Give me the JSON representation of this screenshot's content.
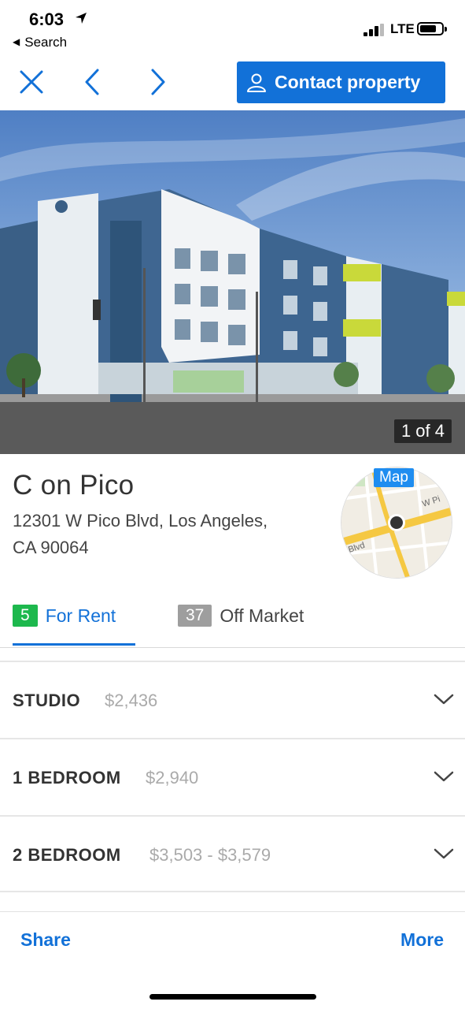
{
  "status_bar": {
    "time": "6:03",
    "back_label": "Search",
    "network": "LTE"
  },
  "nav": {
    "contact_label": "Contact property"
  },
  "gallery": {
    "counter": "1 of 4"
  },
  "property": {
    "name": "C on Pico",
    "address_line1": "12301 W Pico Blvd, Los Angeles,",
    "address_line2": "CA 90064",
    "map_label": "Map",
    "map_street_1": "W Pi",
    "map_street_2": "Blvd"
  },
  "tabs": [
    {
      "count": "5",
      "label": "For Rent"
    },
    {
      "count": "37",
      "label": "Off Market"
    }
  ],
  "floorplans": [
    {
      "name": "STUDIO",
      "price": "$2,436"
    },
    {
      "name": "1 BEDROOM",
      "price": "$2,940"
    },
    {
      "name": "2 BEDROOM",
      "price": "$3,503 - $3,579"
    }
  ],
  "bottom_bar": {
    "share_label": "Share",
    "more_label": "More"
  },
  "colors": {
    "accent": "#1271d8",
    "rent_badge": "#1db84d",
    "off_market_badge": "#9e9e9e"
  }
}
